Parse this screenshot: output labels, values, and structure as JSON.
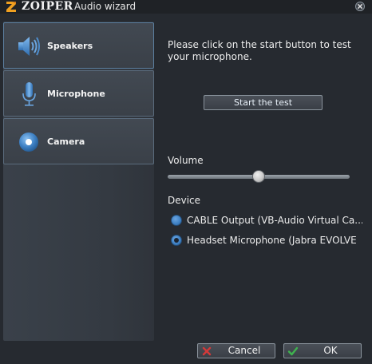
{
  "window": {
    "brand": "ZOIPER",
    "title": "Audio wizard",
    "close_icon": "close-icon"
  },
  "sidebar": {
    "items": [
      {
        "label": "Speakers",
        "icon": "speaker-icon",
        "active": true
      },
      {
        "label": "Microphone",
        "icon": "microphone-icon",
        "active": false
      },
      {
        "label": "Camera",
        "icon": "camera-icon",
        "active": false
      }
    ]
  },
  "main": {
    "instructions": "Please click on the start button to test your microphone.",
    "start_button": "Start the test",
    "volume_label": "Volume",
    "volume_level": 0.5,
    "device_label": "Device",
    "devices": [
      {
        "label": "CABLE Output (VB-Audio Virtual Ca...",
        "selected": false
      },
      {
        "label": "Headset Microphone (Jabra EVOLVE",
        "selected": true
      }
    ]
  },
  "footer": {
    "cancel_label": "Cancel",
    "ok_label": "OK"
  },
  "colors": {
    "background": "#262a30",
    "accent_blue": "#3d7fc2",
    "cancel_red": "#d23a3a",
    "ok_green": "#3fb34f",
    "brand_orange": "#f0a020"
  }
}
